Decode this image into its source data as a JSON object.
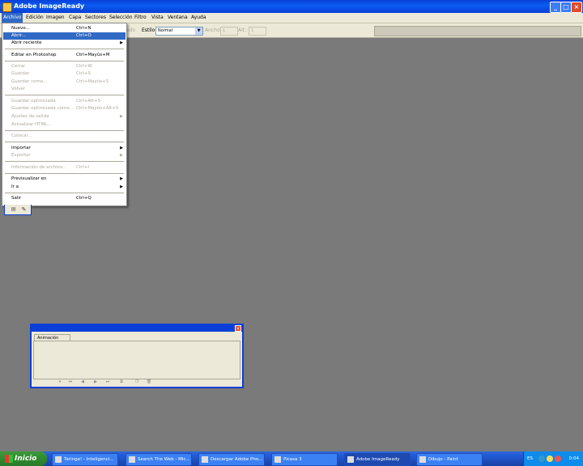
{
  "window": {
    "title": "Adobe ImageReady",
    "buttons": [
      "_",
      "□",
      "×"
    ]
  },
  "menubar": {
    "items": [
      "Archivo",
      "Edición",
      "Imagen",
      "Capa",
      "Sectores",
      "Selección",
      "Filtro",
      "Vista",
      "Ventana",
      "Ayuda"
    ],
    "active": "Archivo"
  },
  "optionsbar": {
    "partial_label": "ado",
    "style_label": "Estilo:",
    "style_value": "Normal",
    "width_label": "Ancho:",
    "width_value": "1",
    "height_label": "Alt.:",
    "height_value": "1"
  },
  "file_menu": {
    "items": [
      {
        "label": "Nuevo...",
        "shortcut": "Ctrl+N",
        "enabled": true
      },
      {
        "label": "Abrir...",
        "shortcut": "Ctrl+O",
        "enabled": true,
        "highlighted": true
      },
      {
        "label": "Abrir reciente",
        "shortcut": "",
        "enabled": true,
        "submenu": true
      },
      {
        "label": "Editar en Photoshop",
        "shortcut": "Ctrl+Mayús+M",
        "enabled": true
      },
      {
        "label": "Cerrar",
        "shortcut": "Ctrl+W",
        "enabled": false
      },
      {
        "label": "Guardar",
        "shortcut": "Ctrl+S",
        "enabled": false
      },
      {
        "label": "Guardar como...",
        "shortcut": "Ctrl+Mayús+S",
        "enabled": false
      },
      {
        "label": "Volver",
        "shortcut": "",
        "enabled": false
      },
      {
        "label": "Guardar optimizada",
        "shortcut": "Ctrl+Alt+S",
        "enabled": false
      },
      {
        "label": "Guardar optimizada como...",
        "shortcut": "Ctrl+Mayús+Alt+S",
        "enabled": false
      },
      {
        "label": "Ajustes de salida",
        "shortcut": "",
        "enabled": false,
        "submenu": true
      },
      {
        "label": "Actualizar HTML...",
        "shortcut": "",
        "enabled": false
      },
      {
        "label": "Colocar...",
        "shortcut": "",
        "enabled": false
      },
      {
        "label": "Importar",
        "shortcut": "",
        "enabled": true,
        "submenu": true
      },
      {
        "label": "Exportar",
        "shortcut": "",
        "enabled": false,
        "submenu": true
      },
      {
        "label": "Información de archivo...",
        "shortcut": "Ctrl+I",
        "enabled": false
      },
      {
        "label": "Previsualizar en",
        "shortcut": "",
        "enabled": true,
        "submenu": true
      },
      {
        "label": "Ir a",
        "shortcut": "",
        "enabled": true,
        "submenu": true
      },
      {
        "label": "Salir",
        "shortcut": "Ctrl+Q",
        "enabled": true
      }
    ]
  },
  "animation_panel": {
    "tab": "Animación",
    "controls": [
      "loop-select",
      "first-frame",
      "prev-frame",
      "play",
      "next-frame",
      "tween",
      "duplicate-frame",
      "delete-frame"
    ]
  },
  "taskbar": {
    "start_label": "Inicio",
    "tasks": [
      {
        "label": "Taringa! - Inteligenci...",
        "active": false
      },
      {
        "label": "Search The Web - Mic...",
        "active": false
      },
      {
        "label": "Descargar Adobe Pho...",
        "active": false
      },
      {
        "label": "Picasa 3",
        "active": false
      },
      {
        "label": "Adobe ImageReady",
        "active": true
      },
      {
        "label": "Dibujo - Paint",
        "active": false
      }
    ],
    "language": "ES",
    "clock": "0:04"
  },
  "colors": {
    "titlebar": "#0a3fd8",
    "highlight": "#316ac5",
    "workspace": "#7a7a7a",
    "panel": "#ece9d8"
  }
}
